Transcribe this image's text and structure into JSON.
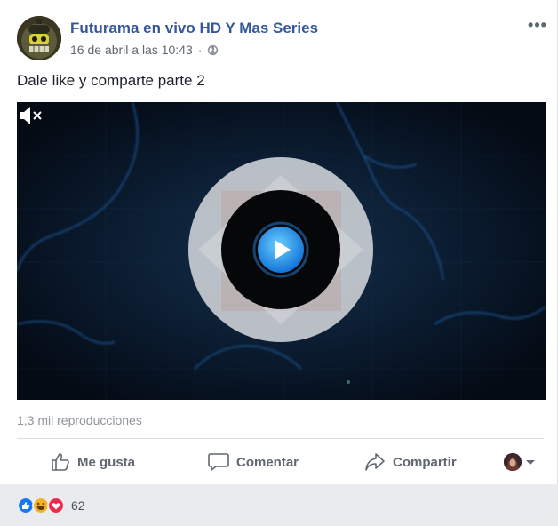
{
  "post": {
    "page_name": "Futurama en vivo HD Y Mas Series",
    "timestamp": "16 de abril a las 10:43",
    "separator": "·",
    "audience_icon": "globe-icon",
    "more_icon": "more-options-icon",
    "more_label": "•••",
    "text": "Dale like y comparte parte 2"
  },
  "video": {
    "state": "paused",
    "play_icon": "play-icon",
    "mute_icon": "muted-speaker-icon",
    "views_label": "1,3 mil reproducciones"
  },
  "actions": {
    "like_label": "Me gusta",
    "comment_label": "Comentar",
    "share_label": "Compartir",
    "accent": "#606770"
  },
  "reactions": {
    "types": [
      "like",
      "haha",
      "love"
    ],
    "count": "62"
  },
  "colors": {
    "link": "#365899",
    "like_blue": "#1877f2",
    "love_red": "#f0284a",
    "haha_yellow": "#f7b125"
  }
}
